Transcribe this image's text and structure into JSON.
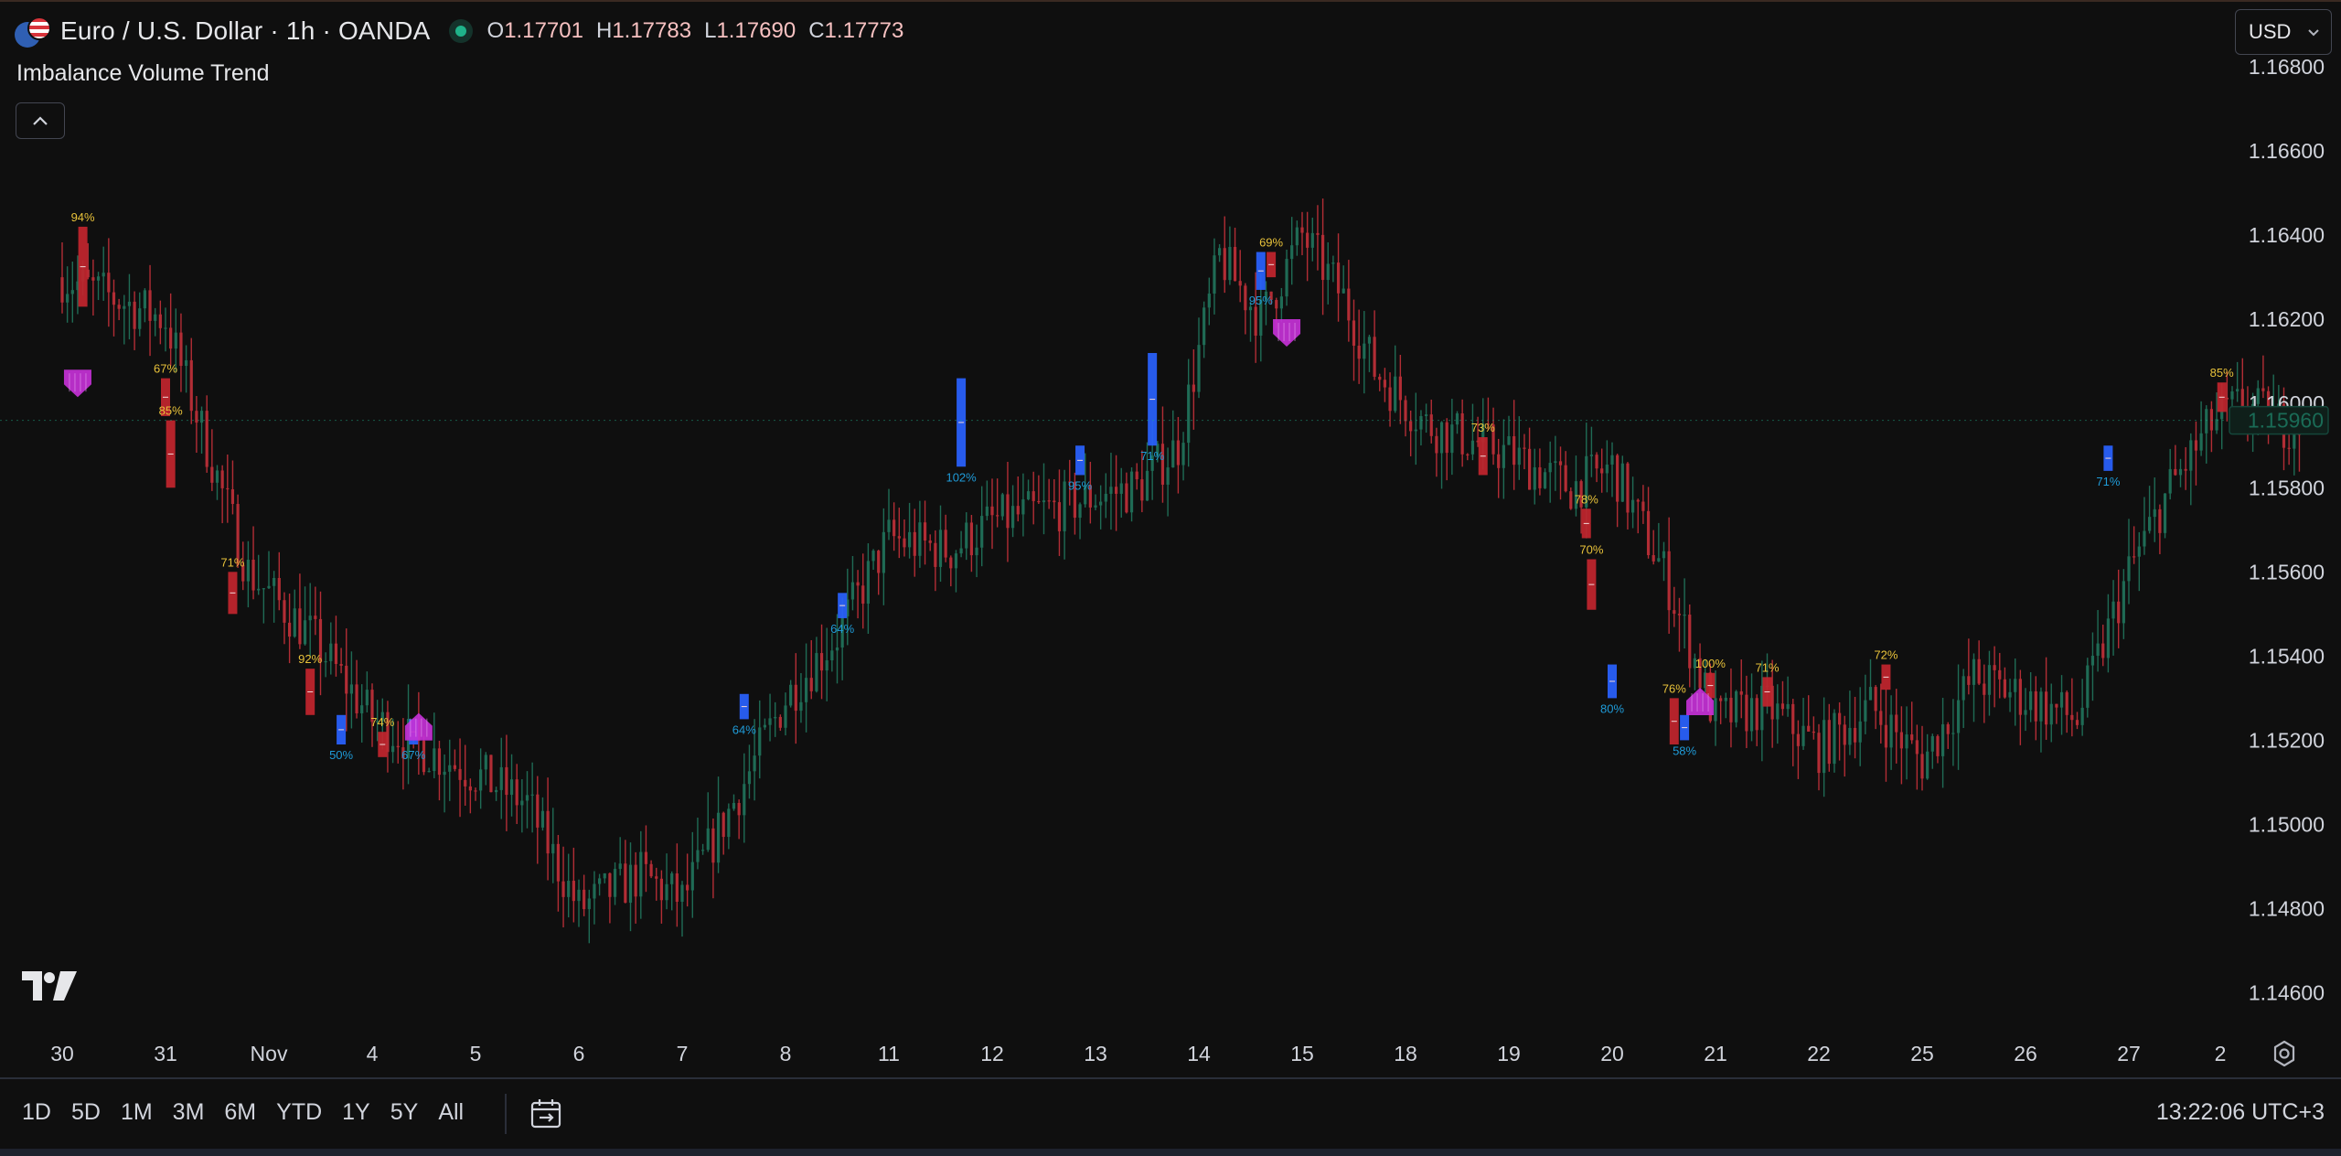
{
  "legend": {
    "symbol_title": "Euro / U.S. Dollar · 1h · OANDA",
    "ohlc": [
      {
        "key": "O",
        "value": "1.17701"
      },
      {
        "key": "H",
        "value": "1.17783"
      },
      {
        "key": "L",
        "value": "1.17690"
      },
      {
        "key": "C",
        "value": "1.17773"
      }
    ]
  },
  "indicator": {
    "title": "Imbalance Volume Trend",
    "collapse_glyph": "^"
  },
  "currency": {
    "label": "USD",
    "chevron": "⌄"
  },
  "bottom_bar": {
    "ranges": [
      "1D",
      "5D",
      "1M",
      "3M",
      "6M",
      "YTD",
      "1Y",
      "5Y",
      "All"
    ],
    "clock": "13:22:06 UTC+3"
  },
  "icons": {
    "logo": "tradingview-logo-icon",
    "settings": "settings-gear-icon",
    "date_range": "calendar-range-icon"
  },
  "colors": {
    "background": "#0f0f0f",
    "bull": "#1f6b55",
    "bear": "#b22d35",
    "imbalance_bull": "#2962ff",
    "imbalance_bear": "#c2252e",
    "label_bull": "#1f9bd8",
    "label_bear": "#e8c23a",
    "signal": "#c431d6",
    "price_tag": "#1fb38a"
  },
  "chart_data": {
    "type": "candlestick",
    "x_tick_labels": [
      "30",
      "31",
      "Nov",
      "4",
      "5",
      "6",
      "7",
      "8",
      "11",
      "12",
      "13",
      "14",
      "15",
      "18",
      "19",
      "20",
      "21",
      "22",
      "25",
      "26",
      "27",
      "2"
    ],
    "y_ticks": [
      1.146,
      1.148,
      1.15,
      1.152,
      1.154,
      1.156,
      1.158,
      1.16,
      1.162,
      1.164,
      1.166,
      1.168
    ],
    "y_tick_labels": [
      "1.14600",
      "1.14800",
      "1.15000",
      "1.15200",
      "1.15400",
      "1.15600",
      "1.15800",
      "1.16000",
      "1.16200",
      "1.16400",
      "1.16600",
      "1.16800"
    ],
    "ylim": [
      1.1446,
      1.1685
    ],
    "last_price": "1.15960",
    "price_path": [
      [
        0,
        1.163
      ],
      [
        1,
        1.162
      ],
      [
        1.8,
        1.156
      ],
      [
        2.4,
        1.1545
      ],
      [
        3,
        1.1525
      ],
      [
        3.5,
        1.1518
      ],
      [
        4,
        1.1512
      ],
      [
        4.5,
        1.1505
      ],
      [
        5,
        1.148
      ],
      [
        5.6,
        1.1488
      ],
      [
        6,
        1.1482
      ],
      [
        6.6,
        1.151
      ],
      [
        7,
        1.153
      ],
      [
        7.5,
        1.1545
      ],
      [
        8,
        1.1568
      ],
      [
        8.6,
        1.1565
      ],
      [
        9,
        1.1572
      ],
      [
        9.6,
        1.1575
      ],
      [
        10,
        1.1578
      ],
      [
        10.4,
        1.158
      ],
      [
        10.8,
        1.159
      ],
      [
        11.2,
        1.1635
      ],
      [
        11.6,
        1.162
      ],
      [
        12,
        1.164
      ],
      [
        12.4,
        1.1625
      ],
      [
        12.7,
        1.1608
      ],
      [
        13.2,
        1.1595
      ],
      [
        14,
        1.1588
      ],
      [
        14.6,
        1.158
      ],
      [
        15,
        1.1585
      ],
      [
        15.5,
        1.156
      ],
      [
        16,
        1.1525
      ],
      [
        16.5,
        1.1528
      ],
      [
        17,
        1.1518
      ],
      [
        17.5,
        1.1528
      ],
      [
        18,
        1.1515
      ],
      [
        18.5,
        1.1535
      ],
      [
        19,
        1.153
      ],
      [
        19.5,
        1.1525
      ],
      [
        20,
        1.156
      ],
      [
        20.4,
        1.158
      ],
      [
        20.8,
        1.1595
      ],
      [
        21.1,
        1.16
      ],
      [
        21.5,
        1.1595
      ],
      [
        21.7,
        1.1596
      ]
    ],
    "imbalance_bars": [
      {
        "x": 0.2,
        "open": 1.1623,
        "close": 1.1642,
        "dir": "bear",
        "label": "94%"
      },
      {
        "x": 1.0,
        "open": 1.1597,
        "close": 1.1606,
        "dir": "bear",
        "label": "67%"
      },
      {
        "x": 1.05,
        "open": 1.158,
        "close": 1.1596,
        "dir": "bear",
        "label": "85%"
      },
      {
        "x": 1.65,
        "open": 1.155,
        "close": 1.156,
        "dir": "bear",
        "label": "71%"
      },
      {
        "x": 2.4,
        "open": 1.1526,
        "close": 1.1537,
        "dir": "bear",
        "label": "92%"
      },
      {
        "x": 2.7,
        "open": 1.1519,
        "close": 1.1526,
        "dir": "bull",
        "label": "50%"
      },
      {
        "x": 3.1,
        "open": 1.1516,
        "close": 1.1522,
        "dir": "bear",
        "label": "74%"
      },
      {
        "x": 3.4,
        "open": 1.1519,
        "close": 1.1525,
        "dir": "bull",
        "label": "67%"
      },
      {
        "x": 6.6,
        "open": 1.1525,
        "close": 1.1531,
        "dir": "bull",
        "label": "64%"
      },
      {
        "x": 7.55,
        "open": 1.1549,
        "close": 1.1555,
        "dir": "bull",
        "label": "64%"
      },
      {
        "x": 8.7,
        "open": 1.1585,
        "close": 1.1606,
        "dir": "bull",
        "label": "102%"
      },
      {
        "x": 9.85,
        "open": 1.1583,
        "close": 1.159,
        "dir": "bull",
        "label": "95%"
      },
      {
        "x": 10.55,
        "open": 1.159,
        "close": 1.1612,
        "dir": "bull",
        "label": "71%"
      },
      {
        "x": 11.6,
        "open": 1.1627,
        "close": 1.1636,
        "dir": "bull",
        "label": "95%"
      },
      {
        "x": 11.7,
        "open": 1.163,
        "close": 1.1636,
        "dir": "bear",
        "label": "69%"
      },
      {
        "x": 13.75,
        "open": 1.1583,
        "close": 1.1592,
        "dir": "bear",
        "label": "73%"
      },
      {
        "x": 14.75,
        "open": 1.1568,
        "close": 1.1575,
        "dir": "bear",
        "label": "78%"
      },
      {
        "x": 14.8,
        "open": 1.1551,
        "close": 1.1563,
        "dir": "bear",
        "label": "70%"
      },
      {
        "x": 15.0,
        "open": 1.153,
        "close": 1.1538,
        "dir": "bull",
        "label": "80%"
      },
      {
        "x": 15.6,
        "open": 1.1519,
        "close": 1.153,
        "dir": "bear",
        "label": "76%"
      },
      {
        "x": 15.7,
        "open": 1.152,
        "close": 1.1526,
        "dir": "bull",
        "label": "58%"
      },
      {
        "x": 15.95,
        "open": 1.153,
        "close": 1.1536,
        "dir": "bear",
        "label": "100%"
      },
      {
        "x": 16.5,
        "open": 1.1528,
        "close": 1.1535,
        "dir": "bear",
        "label": "71%"
      },
      {
        "x": 17.65,
        "open": 1.1532,
        "close": 1.1538,
        "dir": "bear",
        "label": "72%"
      },
      {
        "x": 19.8,
        "open": 1.1584,
        "close": 1.159,
        "dir": "bull",
        "label": "71%"
      },
      {
        "x": 20.9,
        "open": 1.1598,
        "close": 1.1605,
        "dir": "bear",
        "label": "85%"
      }
    ],
    "signals": [
      {
        "x": 0.15,
        "price": 1.1605,
        "dir": "down"
      },
      {
        "x": 3.45,
        "price": 1.1523,
        "dir": "up"
      },
      {
        "x": 11.85,
        "price": 1.1617,
        "dir": "down"
      },
      {
        "x": 15.85,
        "price": 1.1529,
        "dir": "up"
      }
    ]
  }
}
